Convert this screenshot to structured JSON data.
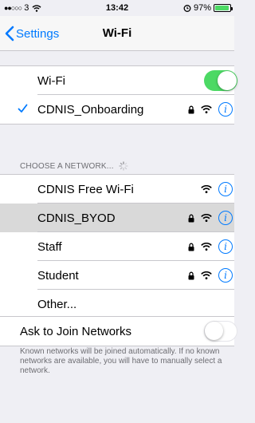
{
  "status_bar": {
    "signal_dots": "●●○○○",
    "carrier": "3",
    "time": "13:42",
    "battery_percent": "97%",
    "battery_level": 0.97
  },
  "nav": {
    "back_label": "Settings",
    "title": "Wi-Fi"
  },
  "wifi_toggle": {
    "label": "Wi-Fi",
    "on": true
  },
  "connected_network": {
    "name": "CDNIS_Onboarding",
    "secured": true
  },
  "section_header": "CHOOSE A NETWORK...",
  "networks": [
    {
      "name": "CDNIS Free Wi-Fi",
      "secured": false
    },
    {
      "name": "CDNIS_BYOD",
      "secured": true
    },
    {
      "name": "Staff",
      "secured": true
    },
    {
      "name": "Student",
      "secured": true
    }
  ],
  "other_label": "Other...",
  "ask_to_join": {
    "label": "Ask to Join Networks",
    "on": false
  },
  "footer": "Known networks will be joined automatically. If no known networks are available, you will have to manually select a network.",
  "colors": {
    "accent": "#007aff",
    "toggle_on": "#4cd964",
    "background": "#efeff4"
  }
}
